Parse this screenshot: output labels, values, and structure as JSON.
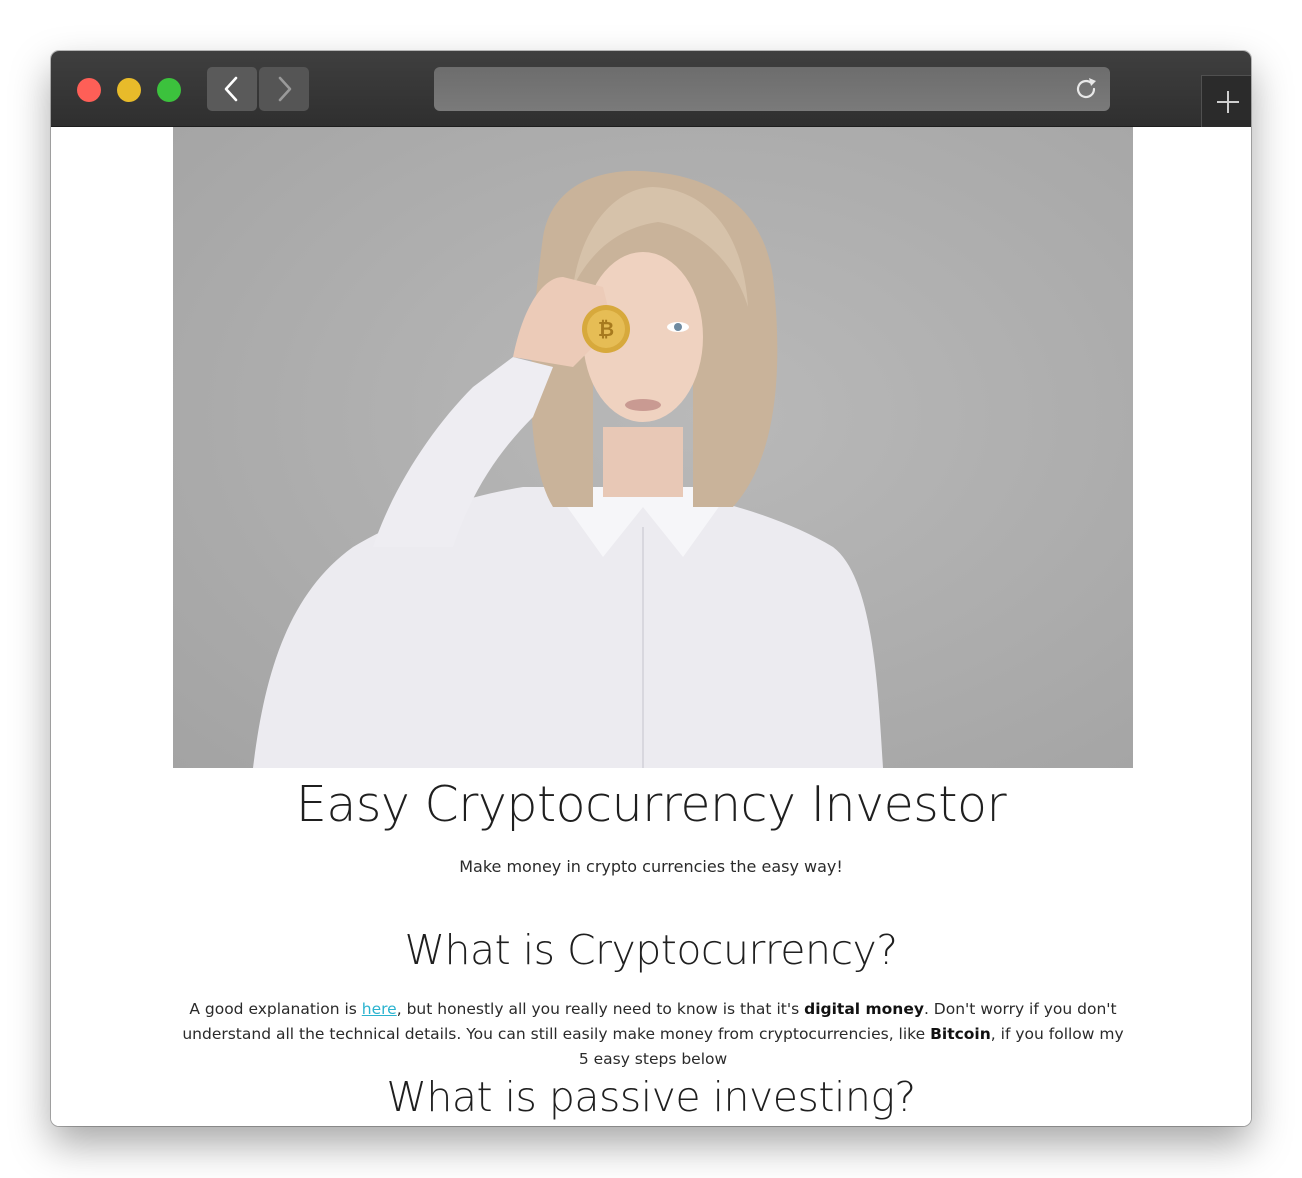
{
  "browser": {
    "url": "",
    "traffic_lights": {
      "close_color": "#fe5f57",
      "minimize_color": "#e8bb2a",
      "zoom_color": "#3cc23d"
    },
    "icons": {
      "back": "chevron-left-icon",
      "forward": "chevron-right-icon",
      "reload": "reload-icon",
      "new_tab": "plus-icon"
    }
  },
  "page": {
    "hero_image": "woman holding a gold bitcoin coin over her eye",
    "title": "Easy Cryptocurrency Investor",
    "subtitle": "Make money in crypto currencies the easy way!",
    "section1": {
      "heading": "What is Cryptocurrency?",
      "p_part1": "A good explanation is ",
      "p_link": "here",
      "p_part2": ", but honestly all you really need to know is that it's ",
      "p_bold1": "digital money",
      "p_part3": ". Don't worry if you don't understand all the technical details. You can still easily make money from cryptocurrencies, like ",
      "p_bold2": "Bitcoin",
      "p_part4": ", if you follow my 5 easy steps below"
    },
    "section2": {
      "heading": "What is passive investing?"
    }
  },
  "colors": {
    "link": "#2bb3cf",
    "titlebar": "#333333",
    "text": "#1f1f1f"
  }
}
